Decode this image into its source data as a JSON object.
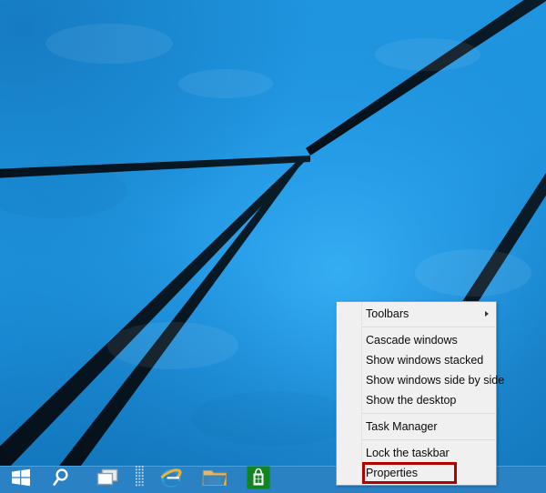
{
  "desktop": {
    "wallpaper": {
      "name": "windows-10-hero-wallpaper",
      "description": "Blue gradient with dark converging light-beam lines",
      "colors": {
        "blue_light": "#29a3ef",
        "blue_mid": "#1c8fd8",
        "blue_dark": "#0f72b8",
        "line_dark": "#07131c"
      }
    }
  },
  "taskbar": {
    "background_color": "#2a82c5",
    "border_color": "#4aa3de",
    "items": [
      {
        "name": "start-button",
        "icon": "windows-logo-icon",
        "label": "Start"
      },
      {
        "name": "search-button",
        "icon": "search-icon",
        "label": "Search"
      },
      {
        "name": "task-view-button",
        "icon": "task-view-icon",
        "label": "Task View"
      },
      {
        "name": "toolbar-handle",
        "icon": "grip-dots-icon",
        "label": "Toolbar handle"
      },
      {
        "name": "internet-explorer-button",
        "icon": "internet-explorer-icon",
        "label": "Internet Explorer"
      },
      {
        "name": "file-explorer-button",
        "icon": "file-explorer-icon",
        "label": "File Explorer"
      },
      {
        "name": "store-button",
        "icon": "windows-store-icon",
        "label": "Store"
      }
    ]
  },
  "context_menu": {
    "name": "taskbar-context-menu",
    "groups": [
      {
        "items": [
          {
            "label": "Toolbars",
            "has_submenu": true,
            "highlighted": false
          }
        ]
      },
      {
        "items": [
          {
            "label": "Cascade windows",
            "has_submenu": false,
            "highlighted": false
          },
          {
            "label": "Show windows stacked",
            "has_submenu": false,
            "highlighted": false
          },
          {
            "label": "Show windows side by side",
            "has_submenu": false,
            "highlighted": false
          },
          {
            "label": "Show the desktop",
            "has_submenu": false,
            "highlighted": false
          }
        ]
      },
      {
        "items": [
          {
            "label": "Task Manager",
            "has_submenu": false,
            "highlighted": false
          }
        ]
      },
      {
        "items": [
          {
            "label": "Lock the taskbar",
            "has_submenu": false,
            "highlighted": false
          },
          {
            "label": "Properties",
            "has_submenu": false,
            "highlighted": true
          }
        ]
      }
    ],
    "background_color": "#f0f0f0",
    "border_color": "#9a9a9a",
    "text_color": "#0a0a0a"
  },
  "annotation": {
    "name": "properties-highlight-box",
    "target_label": "Properties",
    "color": "#b00000",
    "stroke_width": 3
  }
}
